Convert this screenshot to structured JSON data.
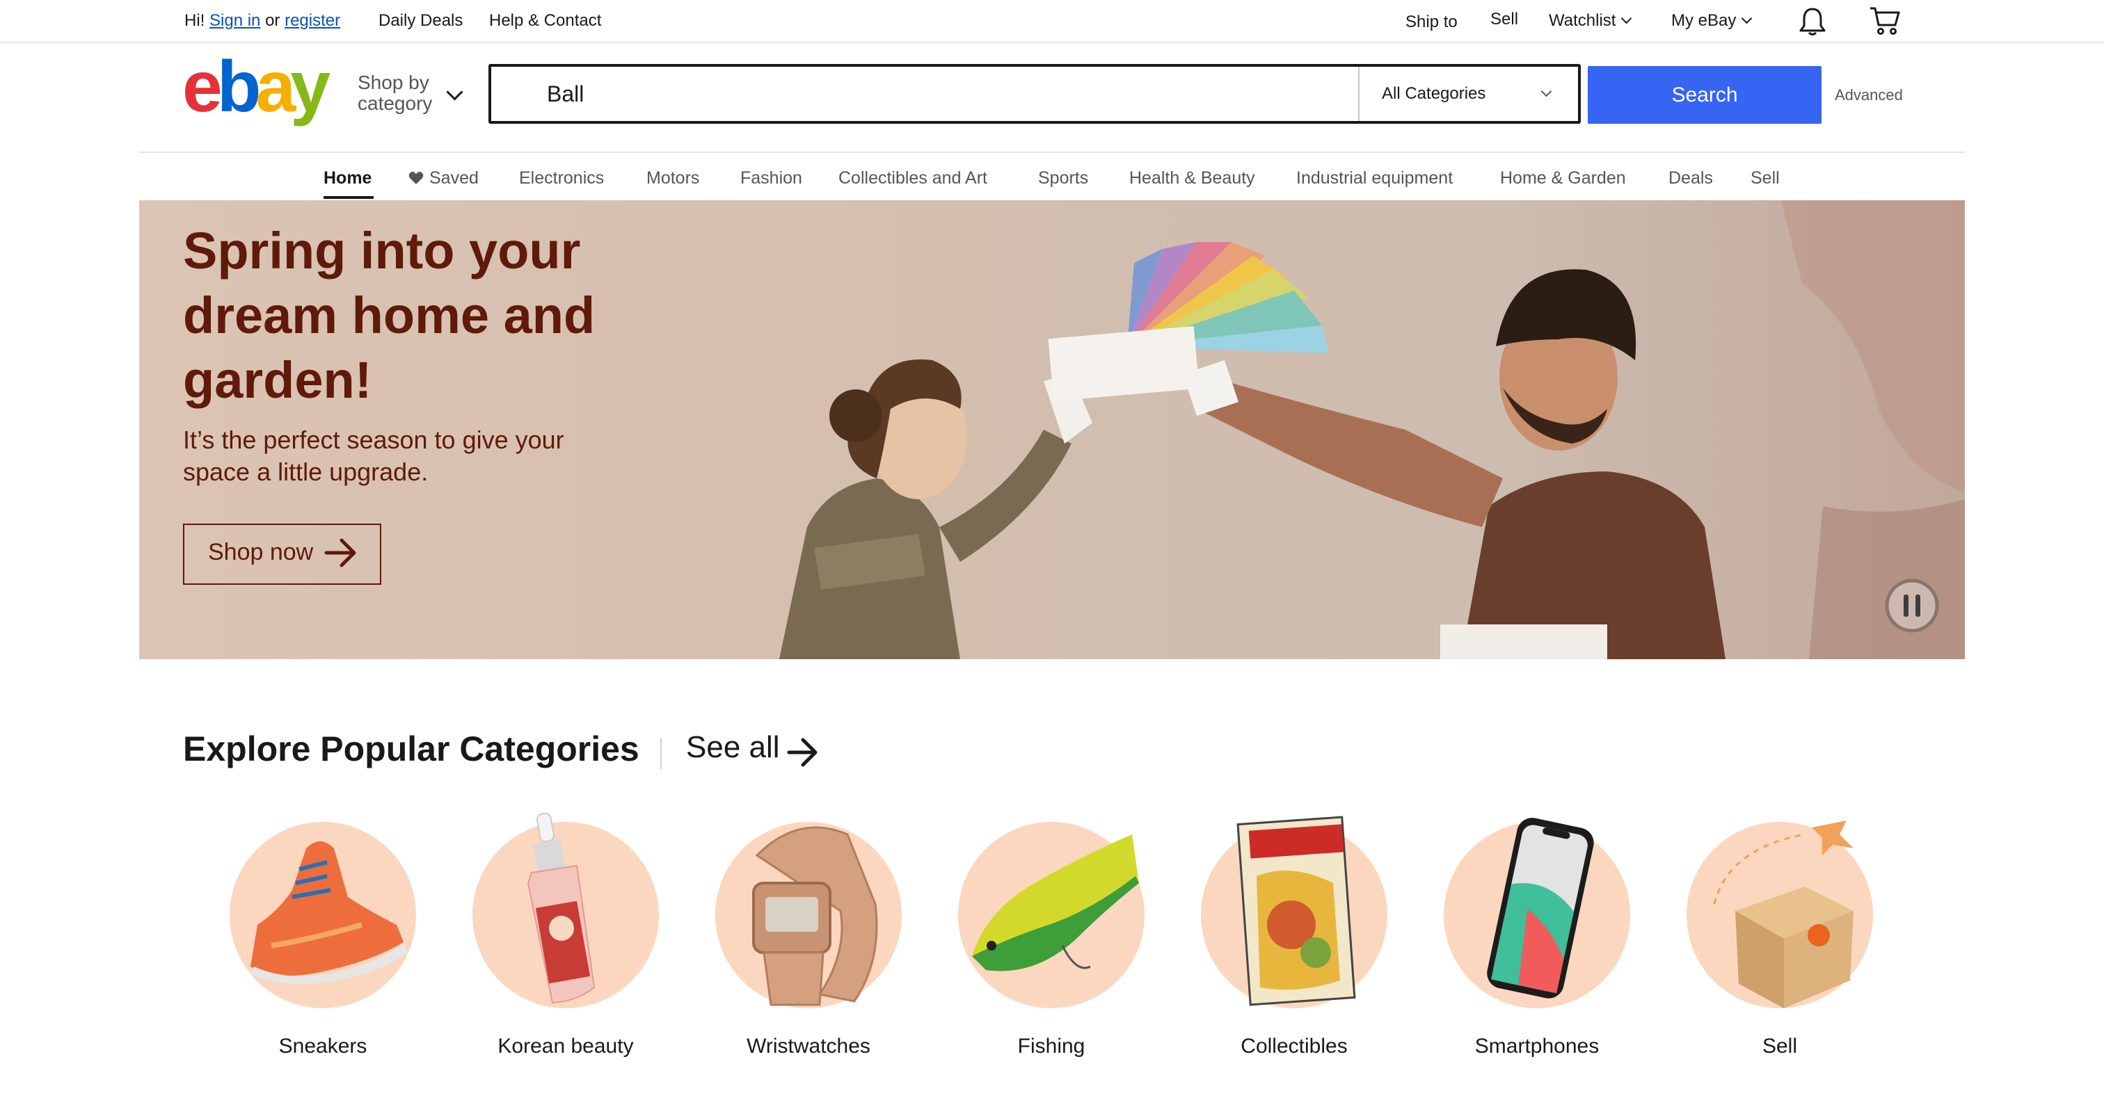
{
  "topbar": {
    "greeting": "Hi!",
    "sign_in": "Sign in",
    "or": "or",
    "register": "register",
    "daily_deals": "Daily Deals",
    "help_contact": "Help & Contact",
    "ship_to": "Ship to",
    "sell": "Sell",
    "watchlist": "Watchlist",
    "my_ebay": "My eBay",
    "icons": [
      "bell-icon",
      "cart-icon"
    ]
  },
  "header": {
    "logo": "ebay",
    "logo_colors": [
      "#e53238",
      "#0064d2",
      "#f5af02",
      "#86b817"
    ],
    "shop_by_line1": "Shop by",
    "shop_by_line2": "category",
    "search_value": "Ball",
    "category_select": "All Categories",
    "search_button": "Search",
    "advanced": "Advanced",
    "accent_color": "#3665f3"
  },
  "nav": {
    "items": [
      "Home",
      "Saved",
      "Electronics",
      "Motors",
      "Fashion",
      "Collectibles and Art",
      "Sports",
      "Health & Beauty",
      "Industrial equipment",
      "Home & Garden",
      "Deals",
      "Sell"
    ],
    "active": "Home"
  },
  "banner": {
    "title": "Spring into your dream home and garden!",
    "subtitle": "It’s the perfect season to give your space a little upgrade.",
    "cta": "Shop now",
    "text_color": "#5f1a0a",
    "background": "#d9c2b3"
  },
  "categories": {
    "heading": "Explore Popular Categories",
    "see_all": "See all",
    "items": [
      {
        "label": "Sneakers",
        "icon": "sneaker-icon"
      },
      {
        "label": "Korean beauty",
        "icon": "serum-bottle-icon"
      },
      {
        "label": "Wristwatches",
        "icon": "wristwatch-icon"
      },
      {
        "label": "Fishing",
        "icon": "fishing-lure-icon"
      },
      {
        "label": "Collectibles",
        "icon": "comic-book-icon"
      },
      {
        "label": "Smartphones",
        "icon": "smartphone-icon"
      },
      {
        "label": "Sell",
        "icon": "package-icon"
      }
    ],
    "circle_color": "#fbd7bf"
  }
}
